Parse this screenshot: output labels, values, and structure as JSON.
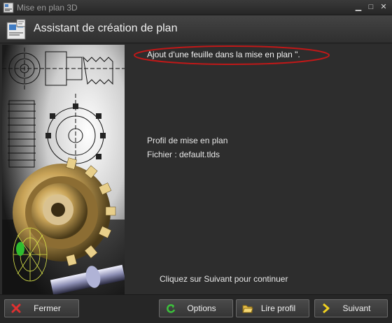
{
  "window": {
    "title": "Mise en plan 3D",
    "minimize_glyph": "▁",
    "maximize_glyph": "□",
    "close_glyph": "✕"
  },
  "header": {
    "title": "Assistant de création de plan",
    "icon": "drawing-sheet-icon"
  },
  "main": {
    "message": "Ajout d'une feuille dans la mise en plan \".",
    "highlight_color": "#c01818",
    "profile_label": "Profil de mise en plan",
    "file_label": "Fichier : default.tlds",
    "hint": "Cliquez sur Suivant pour continuer"
  },
  "footer": {
    "close_button": {
      "label": "Fermer",
      "icon": "close-x-icon"
    },
    "options_button": {
      "label": "Options",
      "icon": "refresh-arrow-icon"
    },
    "load_profile_button": {
      "label": "Lire profil",
      "icon": "open-folder-icon"
    },
    "next_button": {
      "label": "Suivant",
      "icon": "chevron-right-icon"
    }
  }
}
